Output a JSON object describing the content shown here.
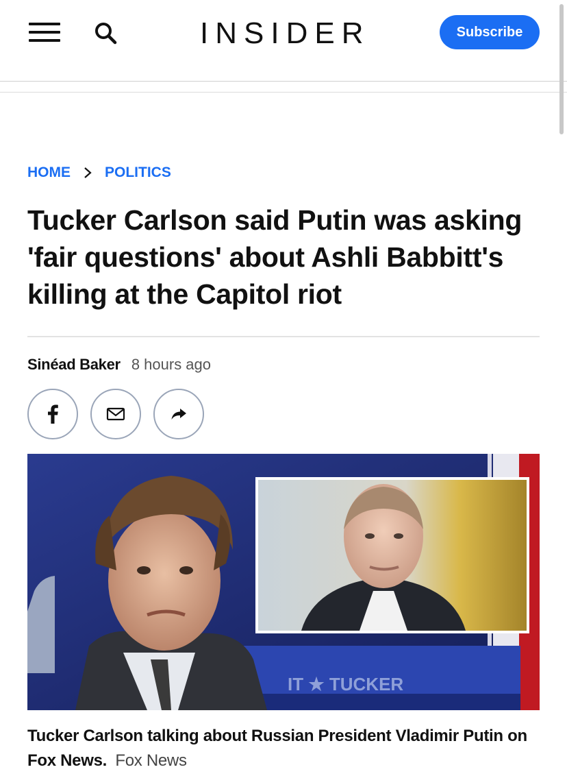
{
  "header": {
    "logo": "INSIDER",
    "subscribe_label": "Subscribe"
  },
  "breadcrumb": {
    "home": "HOME",
    "section": "POLITICS"
  },
  "article": {
    "headline": "Tucker Carlson said Putin was asking 'fair questions' about Ashli Babbitt's killing at the Capitol riot",
    "author": "Sinéad Baker",
    "time": "8 hours ago",
    "hero": {
      "ticker_text": "IT  ★  TUCKER"
    },
    "caption": "Tucker Carlson talking about Russian President Vladimir Putin on Fox News.",
    "credit": "Fox News"
  },
  "share": {
    "icons": [
      "facebook-icon",
      "mail-icon",
      "share-arrow-icon"
    ]
  },
  "colors": {
    "accent": "#1b6ef3",
    "text": "#111111",
    "share_border": "#9aa5b8"
  }
}
